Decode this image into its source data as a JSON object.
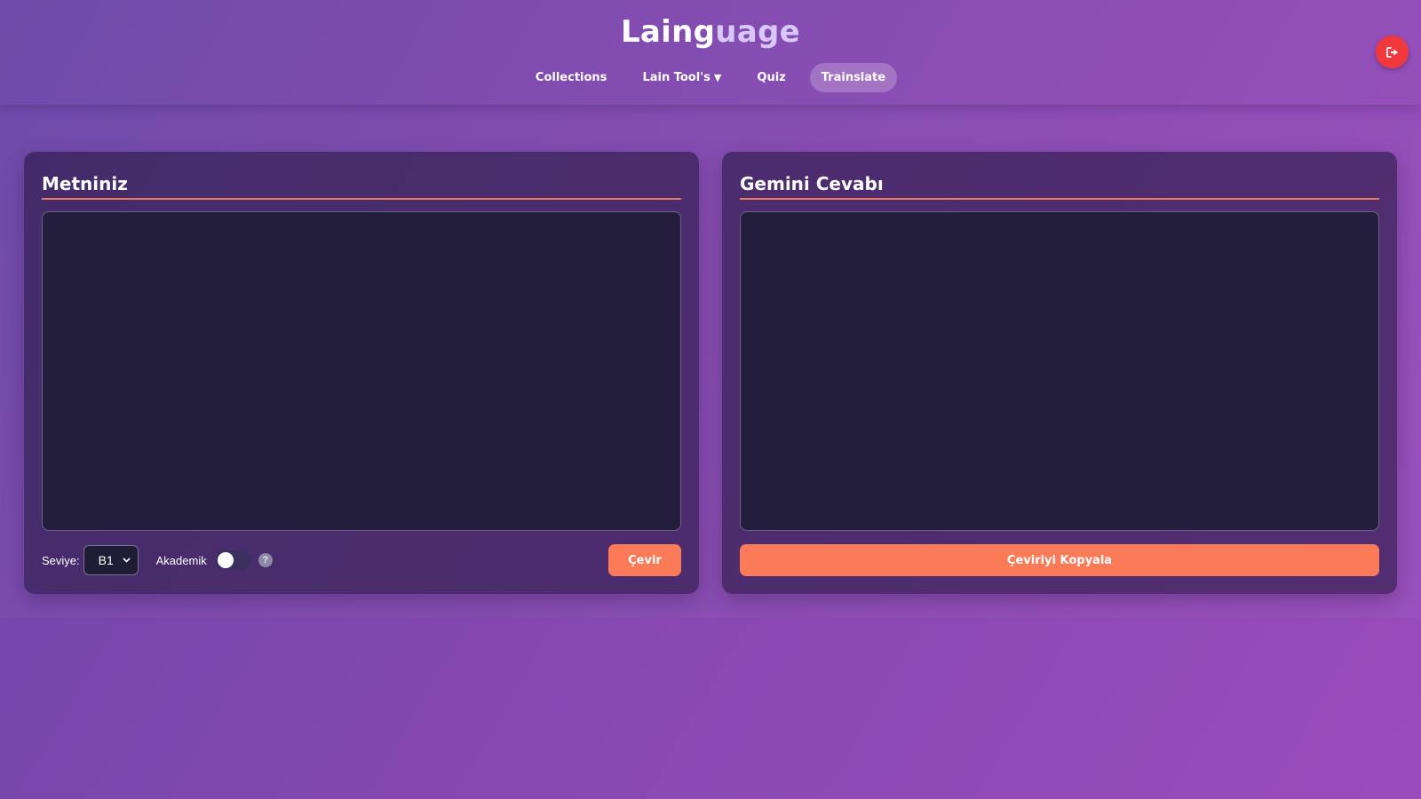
{
  "app": {
    "brand_part1": "Laing",
    "brand_part2": "uage"
  },
  "nav": {
    "items": [
      {
        "label": "Collections"
      },
      {
        "label": "Lain Tool's",
        "caret": "▼"
      },
      {
        "label": "Quiz"
      },
      {
        "label": "Trainslate",
        "active": true
      }
    ]
  },
  "header": {
    "logout_icon": "logout-icon"
  },
  "input_panel": {
    "title": "Metniniz",
    "text_value": "",
    "level_label": "Seviye:",
    "level_value": "B1",
    "academic_label": "Akademik",
    "academic_enabled": false,
    "help_glyph": "?",
    "translate_button": "Çevir"
  },
  "output_panel": {
    "title": "Gemini Cevabı",
    "text_value": "",
    "copy_button": "Çeviriyi Kopyala"
  },
  "colors": {
    "accent": "#fb7a57",
    "logout": "#f2383f",
    "panel_bg": "#221e3b"
  }
}
